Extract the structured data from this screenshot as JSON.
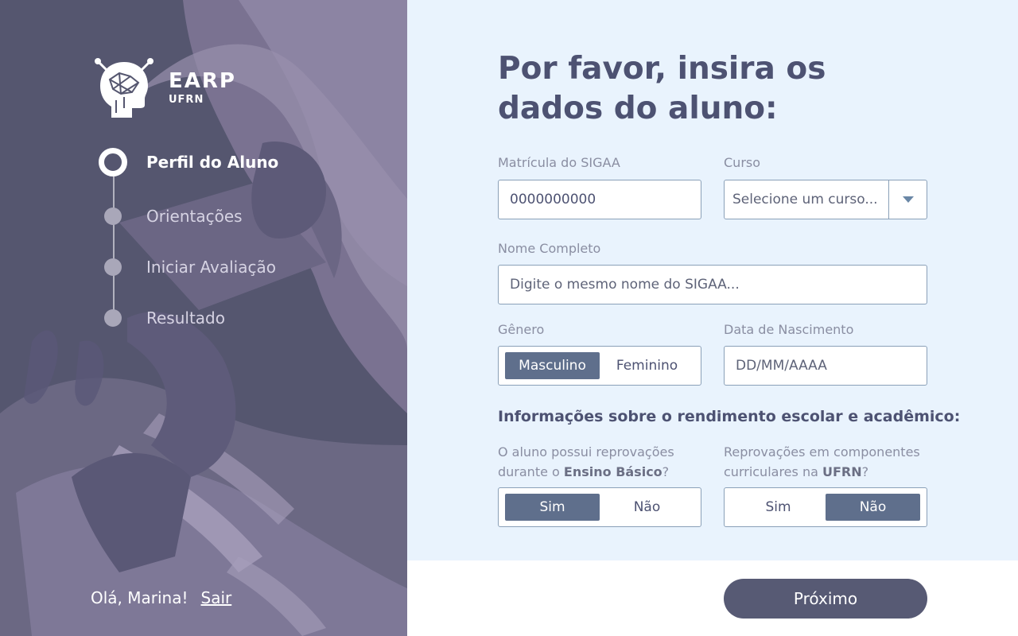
{
  "brand": {
    "name": "EARP",
    "sub": "UFRN"
  },
  "steps": [
    {
      "label": "Perfil do Aluno",
      "active": true
    },
    {
      "label": "Orientações",
      "active": false
    },
    {
      "label": "Iniciar Avaliação",
      "active": false
    },
    {
      "label": "Resultado",
      "active": false
    }
  ],
  "user": {
    "greeting": "Olá, Marina!",
    "logout": "Sair"
  },
  "form": {
    "title": "Por favor, insira os dados do aluno:",
    "matricula": {
      "label": "Matrícula do SIGAA",
      "value": "0000000000"
    },
    "curso": {
      "label": "Curso",
      "placeholder": "Selecione um curso..."
    },
    "nome": {
      "label": "Nome Completo",
      "placeholder": "Digite o mesmo nome do SIGAA..."
    },
    "genero": {
      "label": "Gênero",
      "options": [
        "Masculino",
        "Feminino"
      ],
      "selected": "Masculino"
    },
    "nascimento": {
      "label": "Data de Nascimento",
      "placeholder": "DD/MM/AAAA"
    },
    "section_title": "Informações sobre o rendimento escolar e acadêmico:",
    "q_basico": {
      "text_before": "O aluno possui reprovações durante o ",
      "text_bold": "Ensino Básico",
      "text_after": "?",
      "options": [
        "Sim",
        "Não"
      ],
      "selected": "Sim"
    },
    "q_ufrn": {
      "text_before": "Reprovações em componentes curriculares na ",
      "text_bold": "UFRN",
      "text_after": "?",
      "options": [
        "Sim",
        "Não"
      ],
      "selected": "Não"
    },
    "next_label": "Próximo"
  },
  "colors": {
    "sidebar": "#55566f",
    "accent": "#5f6f8c",
    "background": "#e9f3fd",
    "button": "#575a74"
  }
}
